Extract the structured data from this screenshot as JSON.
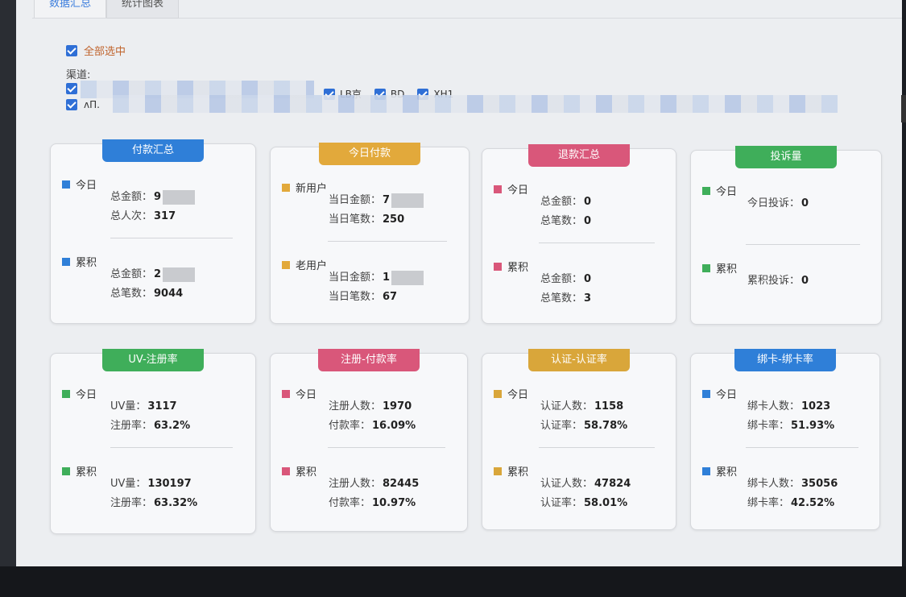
{
  "tabs": [
    "数据汇总",
    "统计图表"
  ],
  "select_all_label": "全部选中",
  "channels_label": "渠道:",
  "channel_visible": [
    "LB京",
    "BD",
    "XH1"
  ],
  "channel_row2_prefix": "ᴧΠ.",
  "colors": {
    "blue": "#2f7fd8",
    "yellow": "#e2a93b",
    "pink": "#d9577a",
    "green": "#3fae5a",
    "gold": "#d9a63a"
  },
  "cards": [
    {
      "title": "付款汇总",
      "color": "blue",
      "s1": "今日",
      "s1_items": [
        [
          "总金额：",
          "9"
        ],
        [
          "总人次：",
          "317"
        ]
      ],
      "s2": "累积",
      "s2_items": [
        [
          "总金额：",
          "2"
        ],
        [
          "总笔数：",
          "9044"
        ]
      ]
    },
    {
      "title": "今日付款",
      "color": "yellow",
      "s1": "新用户",
      "s1_items": [
        [
          "当日金额：",
          "7"
        ],
        [
          "当日笔数：",
          "250"
        ]
      ],
      "s2": "老用户",
      "s2_items": [
        [
          "当日金额：",
          "1"
        ],
        [
          "当日笔数：",
          "67"
        ]
      ]
    },
    {
      "title": "退款汇总",
      "color": "pink",
      "s1": "今日",
      "s1_items": [
        [
          "总金额：",
          "0"
        ],
        [
          "总笔数：",
          "0"
        ]
      ],
      "s2": "累积",
      "s2_items": [
        [
          "总金额：",
          "0"
        ],
        [
          "总笔数：",
          "3"
        ]
      ]
    },
    {
      "title": "投诉量",
      "color": "green",
      "s1": "今日",
      "s1_items": [
        [
          "今日投诉：",
          "0"
        ]
      ],
      "s2": "累积",
      "s2_items": [
        [
          "累积投诉：",
          "0"
        ]
      ]
    },
    {
      "title": "UV-注册率",
      "color": "green",
      "s1": "今日",
      "s1_items": [
        [
          "UV量：",
          "3117"
        ],
        [
          "注册率：",
          "63.2%"
        ]
      ],
      "s2": "累积",
      "s2_items": [
        [
          "UV量：",
          "130197"
        ],
        [
          "注册率：",
          "63.32%"
        ]
      ]
    },
    {
      "title": "注册-付款率",
      "color": "pink",
      "s1": "今日",
      "s1_items": [
        [
          "注册人数：",
          "1970"
        ],
        [
          "付款率：",
          "16.09%"
        ]
      ],
      "s2": "累积",
      "s2_items": [
        [
          "注册人数：",
          "82445"
        ],
        [
          "付款率：",
          "10.97%"
        ]
      ]
    },
    {
      "title": "认证-认证率",
      "color": "gold",
      "s1": "今日",
      "s1_items": [
        [
          "认证人数：",
          "1158"
        ],
        [
          "认证率：",
          "58.78%"
        ]
      ],
      "s2": "累积",
      "s2_items": [
        [
          "认证人数：",
          "47824"
        ],
        [
          "认证率：",
          "58.01%"
        ]
      ]
    },
    {
      "title": "绑卡-绑卡率",
      "color": "blue",
      "s1": "今日",
      "s1_items": [
        [
          "绑卡人数：",
          "1023"
        ],
        [
          "绑卡率：",
          "51.93%"
        ]
      ],
      "s2": "累积",
      "s2_items": [
        [
          "绑卡人数：",
          "35056"
        ],
        [
          "绑卡率：",
          "42.52%"
        ]
      ]
    }
  ]
}
